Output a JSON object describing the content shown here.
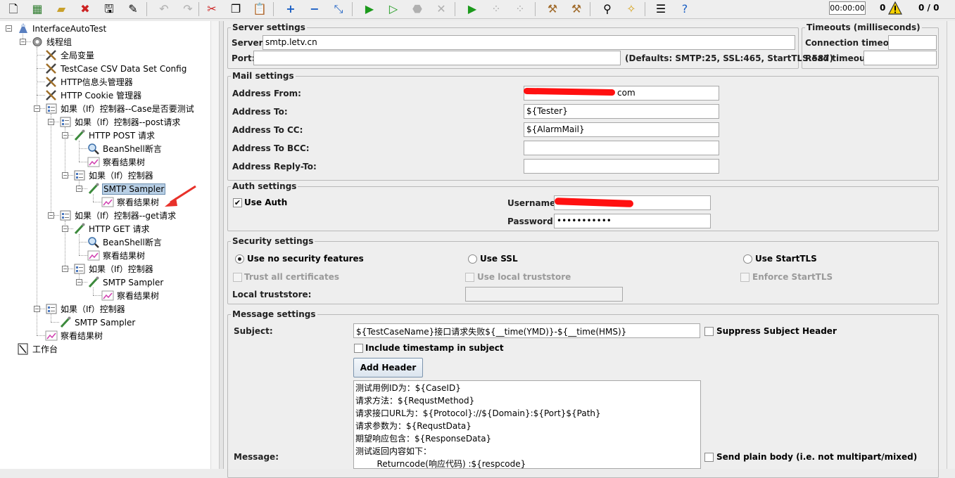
{
  "toolbar": {
    "buttons": [
      "new-icon",
      "templates-icon",
      "open-icon",
      "close-icon",
      "save-icon",
      "save-as-icon",
      "undo-icon",
      "redo-icon",
      "cut-icon",
      "copy-icon",
      "paste-icon",
      "expand-icon",
      "collapse-icon",
      "toggle-icon",
      "start-icon",
      "start-no-pause-icon",
      "stop-icon",
      "shutdown-icon",
      "remote-start-icon",
      "remote-stop-icon",
      "remote-shutdown-icon",
      "clear-icon",
      "clear-all-icon",
      "search-icon",
      "reset-search-icon",
      "function-helper-icon",
      "help-icon"
    ],
    "timer": "00:00:00",
    "error_count": "0",
    "threads": "0 / 0"
  },
  "tree": {
    "nodes": [
      {
        "label": "InterfaceAutoTest"
      },
      {
        "label": "线程组"
      },
      {
        "label": "全局变量"
      },
      {
        "label": "TestCase CSV Data Set Config"
      },
      {
        "label": "HTTP信息头管理器"
      },
      {
        "label": "HTTP Cookie 管理器"
      },
      {
        "label": "如果（If）控制器--Case是否要测试"
      },
      {
        "label": "如果（If）控制器--post请求"
      },
      {
        "label": "HTTP POST 请求"
      },
      {
        "label": "BeanShell断言"
      },
      {
        "label": "察看结果树"
      },
      {
        "label": "如果（If）控制器"
      },
      {
        "label": "SMTP Sampler"
      },
      {
        "label": "察看结果树"
      },
      {
        "label": "如果（If）控制器--get请求"
      },
      {
        "label": "HTTP GET 请求"
      },
      {
        "label": "BeanShell断言"
      },
      {
        "label": "察看结果树"
      },
      {
        "label": "如果（If）控制器"
      },
      {
        "label": "SMTP Sampler"
      },
      {
        "label": "察看结果树"
      },
      {
        "label": "如果（If）控制器"
      },
      {
        "label": "SMTP Sampler"
      },
      {
        "label": "察看结果树"
      },
      {
        "label": "工作台"
      }
    ]
  },
  "server": {
    "legend": "Server settings",
    "server_label": "Server:",
    "server_value": "smtp.letv.cn",
    "port_label": "Port:",
    "port_value": "",
    "defaults": "(Defaults: SMTP:25, SSL:465, StartTLS:587)"
  },
  "timeouts": {
    "legend": "Timeouts (milliseconds)",
    "conn_label": "Connection timeout:",
    "conn_value": "",
    "read_label": "Read timeout:",
    "read_value": ""
  },
  "mail": {
    "legend": "Mail settings",
    "from_label": "Address From:",
    "from_value": "com",
    "to_label": "Address To:",
    "to_value": "${Tester}",
    "cc_label": "Address To CC:",
    "cc_value": "${AlarmMail}",
    "bcc_label": "Address To BCC:",
    "bcc_value": "",
    "reply_label": "Address Reply-To:",
    "reply_value": ""
  },
  "auth": {
    "legend": "Auth settings",
    "use_auth": "Use Auth",
    "use_auth_checked": true,
    "user_label": "Username:",
    "user_value": "",
    "pass_label": "Password:",
    "pass_value": "•••••••••••"
  },
  "security": {
    "legend": "Security settings",
    "no_security": "Use no security features",
    "use_ssl": "Use SSL",
    "use_starttls": "Use StartTLS",
    "selected": "no_security",
    "trust_all": "Trust all certificates",
    "local_store": "Use local truststore",
    "enforce": "Enforce StartTLS",
    "local_label": "Local truststore:",
    "local_value": ""
  },
  "message": {
    "legend": "Message settings",
    "subject_label": "Subject:",
    "subject_value": "${TestCaseName}接口请求失败${__time(YMD)}-${__time(HMS)}",
    "suppress": "Suppress Subject Header",
    "include_ts": "Include timestamp in subject",
    "add_header": "Add Header",
    "message_label": "Message:",
    "send_plain": "Send plain body (i.e. not multipart/mixed)",
    "lines": [
      "测试用例ID为：${CaseID}",
      "请求方法：${RequstMethod}",
      "请求接口URL为：${Protocol}://${Domain}:${Port}${Path}",
      "请求参数为：${RequstData}",
      "期望响应包含：${ResponseData}",
      "测试返回内容如下：",
      "        Returncode(响应代码) :${respcode}"
    ]
  },
  "colors": {
    "selection": "#b8cfe5",
    "redaction": "#ff1010",
    "arrow": "#e8312a"
  }
}
